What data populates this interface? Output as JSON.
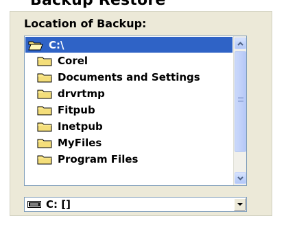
{
  "header": {
    "cut_title": "Backup Restore"
  },
  "backup": {
    "location_label": "Location of Backup:",
    "root": {
      "label": "C:\\",
      "icon": "open-folder-icon",
      "selected": true
    },
    "folders": [
      {
        "label": "Corel",
        "icon": "folder-icon"
      },
      {
        "label": "Documents and Settings",
        "icon": "folder-icon"
      },
      {
        "label": "drvrtmp",
        "icon": "folder-icon"
      },
      {
        "label": "Fitpub",
        "icon": "folder-icon"
      },
      {
        "label": "Inetpub",
        "icon": "folder-icon"
      },
      {
        "label": "MyFiles",
        "icon": "folder-icon"
      },
      {
        "label": "Program Files",
        "icon": "folder-icon"
      }
    ],
    "drive": {
      "value": "C: []",
      "icon": "hard-drive-icon"
    }
  },
  "colors": {
    "selection": "#2f63c6",
    "panel": "#ece9d8",
    "border": "#7f9db9",
    "folder": "#f4de7a"
  }
}
